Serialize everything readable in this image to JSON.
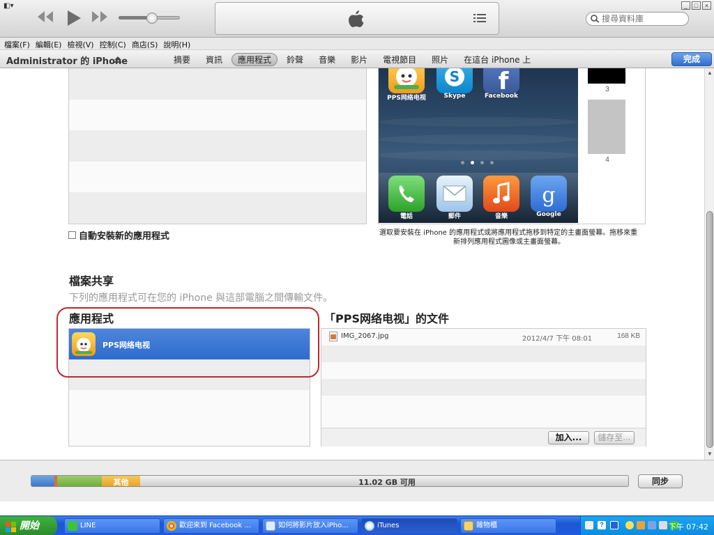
{
  "player": {
    "search_placeholder": "搜尋資料庫"
  },
  "menu": [
    "檔案(F)",
    "編輯(E)",
    "檢視(V)",
    "控制(C)",
    "商店(S)",
    "說明(H)"
  ],
  "device": {
    "name": "Administrator 的 iPhone",
    "tabs": [
      "摘要",
      "資訊",
      "應用程式",
      "鈴聲",
      "音樂",
      "影片",
      "電視節目",
      "照片",
      "在這台 iPhone 上"
    ],
    "active_tab": "應用程式",
    "done_label": "完成"
  },
  "phone_preview": {
    "top_apps": [
      "PPS网络电视",
      "Skype",
      "Facebook"
    ],
    "dock_apps": [
      "電話",
      "郵件",
      "音樂",
      "Google"
    ],
    "page_numbers": [
      "3",
      "4"
    ],
    "page_dots": 4,
    "current_page_dot": 2
  },
  "auto_install_label": "自動安裝新的應用程式",
  "phone_help_line1": "選取要安裝在 iPhone 的應用程式或將應用程式拖移到特定的主畫面螢幕。拖移來重",
  "phone_help_line2": "新排列應用程式圖像或主畫面螢幕。",
  "file_sharing": {
    "title": "檔案共享",
    "description": "下列的應用程式可在您的 iPhone 與這部電腦之間傳輸文件。",
    "apps_title": "應用程式",
    "docs_title": "「PPS网络电视」的文件",
    "selected_app": "PPS网络电视",
    "documents": [
      {
        "name": "IMG_2067.jpg",
        "date": "2012/4/7 下午 08:01",
        "size": "168 KB"
      }
    ],
    "add_label": "加入...",
    "save_label": "儲存至..."
  },
  "capacity": {
    "other_label": "其他",
    "free_label": "11.02 GB 可用",
    "sync_label": "同步",
    "colors": {
      "audio": "#3b78c9",
      "apps": "#e36a3a",
      "photos": "#6fae3d",
      "other": "#e7a42a"
    }
  },
  "taskbar": {
    "start_label": "開始",
    "tasks": [
      "LINE",
      "歡迎來到 Facebook ...",
      "如何將影片放入iPho...",
      "iTunes",
      "雜物櫃"
    ],
    "active_task": "iTunes",
    "clock": "下午 07:42"
  }
}
